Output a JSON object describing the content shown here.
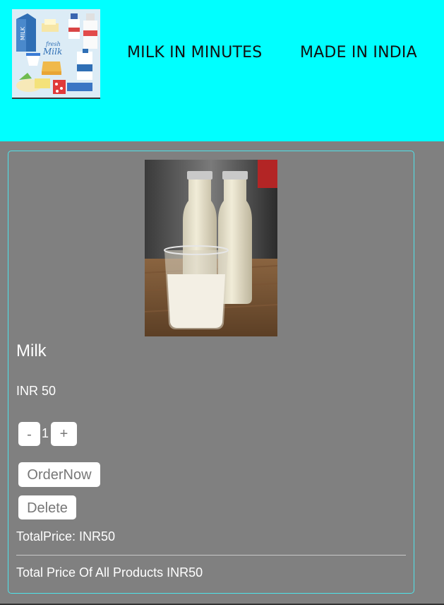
{
  "header": {
    "logo_text": "fresh Milk",
    "nav": [
      "MILK IN MINUTES",
      "MADE IN INDIA"
    ],
    "background": "#00ffff"
  },
  "product": {
    "name": "Milk",
    "price": "INR 50",
    "quantity": "1",
    "decrement_label": "-",
    "increment_label": "+",
    "order_label": "OrderNow",
    "delete_label": "Delete",
    "total_price": "TotalPrice: INR50"
  },
  "summary": {
    "grand_total": "Total Price Of All Products INR50"
  }
}
